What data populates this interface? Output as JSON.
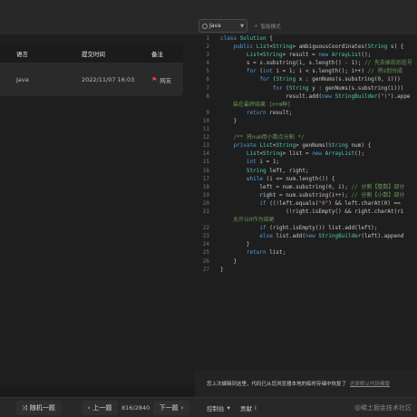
{
  "editor_header": {
    "language": "Java",
    "mode_toggle": "智能模式"
  },
  "submissions": {
    "headers": [
      "语言",
      "提交时间",
      "备注"
    ],
    "rows": [
      {
        "language": "Java",
        "time": "2022/11/07 16:03",
        "note": "网友"
      }
    ]
  },
  "code": {
    "lines": [
      {
        "n": "1",
        "segs": [
          [
            "k",
            "class "
          ],
          [
            "t",
            "Solution"
          ],
          [
            "p",
            " {"
          ]
        ]
      },
      {
        "n": "2",
        "segs": [
          [
            "p",
            "    "
          ],
          [
            "k",
            "public "
          ],
          [
            "t",
            "List"
          ],
          [
            "p",
            "<"
          ],
          [
            "t",
            "String"
          ],
          [
            "p",
            "> ambiguousCoordinates("
          ],
          [
            "t",
            "String"
          ],
          [
            "p",
            " s) {"
          ]
        ]
      },
      {
        "n": "3",
        "segs": [
          [
            "p",
            "        "
          ],
          [
            "t",
            "List"
          ],
          [
            "p",
            "<"
          ],
          [
            "t",
            "String"
          ],
          [
            "p",
            "> result = "
          ],
          [
            "k",
            "new "
          ],
          [
            "t",
            "ArrayList"
          ],
          [
            "p",
            "();"
          ]
        ]
      },
      {
        "n": "4",
        "segs": [
          [
            "p",
            "        s = s.substring("
          ],
          [
            "n",
            "1"
          ],
          [
            "p",
            ", s.length() - "
          ],
          [
            "n",
            "1"
          ],
          [
            "p",
            "); "
          ],
          [
            "cm",
            "// 先去掉前后括号"
          ]
        ]
      },
      {
        "n": "5",
        "segs": [
          [
            "p",
            "        "
          ],
          [
            "k",
            "for "
          ],
          [
            "p",
            "("
          ],
          [
            "k",
            "int "
          ],
          [
            "p",
            "i = "
          ],
          [
            "n",
            "1"
          ],
          [
            "p",
            "; i < s.length(); i++) "
          ],
          [
            "cm",
            "// 将s划分成"
          ]
        ]
      },
      {
        "n": "6",
        "segs": [
          [
            "p",
            "            "
          ],
          [
            "k",
            "for "
          ],
          [
            "p",
            "("
          ],
          [
            "t",
            "String"
          ],
          [
            "p",
            " x : genNums(s.substring("
          ],
          [
            "n",
            "0"
          ],
          [
            "p",
            ", i)))"
          ]
        ]
      },
      {
        "n": "7",
        "segs": [
          [
            "p",
            "                "
          ],
          [
            "k",
            "for "
          ],
          [
            "p",
            "("
          ],
          [
            "t",
            "String"
          ],
          [
            "p",
            " y : genNums(s.substring(i)))"
          ]
        ]
      },
      {
        "n": "8",
        "segs": [
          [
            "p",
            "                    result.add("
          ],
          [
            "k",
            "new "
          ],
          [
            "t",
            "StringBuilder"
          ],
          [
            "p",
            "("
          ],
          [
            "s",
            "\"(\""
          ],
          [
            "p",
            ").appe"
          ]
        ]
      },
      {
        "n": "",
        "wrap": true,
        "segs": [
          [
            "cm",
            "装在最终结果 [n+m种]"
          ]
        ]
      },
      {
        "n": "9",
        "segs": [
          [
            "p",
            "        "
          ],
          [
            "k",
            "return "
          ],
          [
            "p",
            "result;"
          ]
        ]
      },
      {
        "n": "10",
        "segs": [
          [
            "p",
            "    }"
          ]
        ]
      },
      {
        "n": "11",
        "segs": []
      },
      {
        "n": "12",
        "segs": [
          [
            "p",
            "    "
          ],
          [
            "cm",
            "/** 将num用小数点分割 */"
          ]
        ]
      },
      {
        "n": "13",
        "segs": [
          [
            "p",
            "    "
          ],
          [
            "k",
            "private "
          ],
          [
            "t",
            "List"
          ],
          [
            "p",
            "<"
          ],
          [
            "t",
            "String"
          ],
          [
            "p",
            "> genNums("
          ],
          [
            "t",
            "String"
          ],
          [
            "p",
            " num) {"
          ]
        ]
      },
      {
        "n": "14",
        "segs": [
          [
            "p",
            "        "
          ],
          [
            "t",
            "List"
          ],
          [
            "p",
            "<"
          ],
          [
            "t",
            "String"
          ],
          [
            "p",
            "> list = "
          ],
          [
            "k",
            "new "
          ],
          [
            "t",
            "ArrayList"
          ],
          [
            "p",
            "();"
          ]
        ]
      },
      {
        "n": "15",
        "segs": [
          [
            "p",
            "        "
          ],
          [
            "k",
            "int "
          ],
          [
            "p",
            "i = "
          ],
          [
            "n",
            "1"
          ],
          [
            "p",
            ";"
          ]
        ]
      },
      {
        "n": "16",
        "segs": [
          [
            "p",
            "        "
          ],
          [
            "t",
            "String"
          ],
          [
            "p",
            " left, right;"
          ]
        ]
      },
      {
        "n": "17",
        "segs": [
          [
            "p",
            "        "
          ],
          [
            "k",
            "while "
          ],
          [
            "p",
            "(i <= num.length()) {"
          ]
        ]
      },
      {
        "n": "18",
        "segs": [
          [
            "p",
            "            left = num.substring("
          ],
          [
            "n",
            "0"
          ],
          [
            "p",
            ", i); "
          ],
          [
            "cm",
            "// 分割【整数】部分"
          ]
        ]
      },
      {
        "n": "19",
        "segs": [
          [
            "p",
            "            right = num.substring(i++); "
          ],
          [
            "cm",
            "// 分割【小数】部分"
          ]
        ]
      },
      {
        "n": "20",
        "segs": [
          [
            "p",
            "            "
          ],
          [
            "k",
            "if "
          ],
          [
            "p",
            "((!left.equals("
          ],
          [
            "s",
            "\"0\""
          ],
          [
            "p",
            ") && left.charAt("
          ],
          [
            "n",
            "0"
          ],
          [
            "p",
            ") =="
          ]
        ]
      },
      {
        "n": "21",
        "segs": [
          [
            "p",
            "                    (!right.isEmpty() && right.charAt(ri"
          ]
        ]
      },
      {
        "n": "",
        "wrap": true,
        "segs": [
          [
            "cm",
            "允许以0作为结尾"
          ]
        ]
      },
      {
        "n": "22",
        "segs": [
          [
            "p",
            "            "
          ],
          [
            "k",
            "if "
          ],
          [
            "p",
            "(right.isEmpty()) list.add(left);"
          ]
        ]
      },
      {
        "n": "23",
        "segs": [
          [
            "p",
            "            "
          ],
          [
            "k",
            "else "
          ],
          [
            "p",
            "list.add("
          ],
          [
            "k",
            "new "
          ],
          [
            "t",
            "StringBuilder"
          ],
          [
            "p",
            "(left).append"
          ]
        ]
      },
      {
        "n": "24",
        "segs": [
          [
            "p",
            "        }"
          ]
        ]
      },
      {
        "n": "25",
        "segs": [
          [
            "p",
            "        "
          ],
          [
            "k",
            "return "
          ],
          [
            "p",
            "list;"
          ]
        ]
      },
      {
        "n": "26",
        "segs": [
          [
            "p",
            "    }"
          ]
        ]
      },
      {
        "n": "27",
        "segs": [
          [
            "p",
            "}"
          ]
        ]
      }
    ]
  },
  "notice": {
    "text": "您上次编辑到这里，代码已从您浏览器本地的临时存储中恢复了",
    "link": "还原默认代码模版"
  },
  "bottom": {
    "random": "随机一题",
    "prev": "上一题",
    "counter": "816/2840",
    "next": "下一题",
    "console": "控制台",
    "contrib": "贡献",
    "watermark": "@稀土掘金技术社区"
  },
  "colors": {
    "keyword": "#569cd6",
    "type": "#4ec9b0",
    "number": "#b5cea8",
    "string": "#ce9178",
    "comment": "#6a9955",
    "flag": "#e04848"
  }
}
